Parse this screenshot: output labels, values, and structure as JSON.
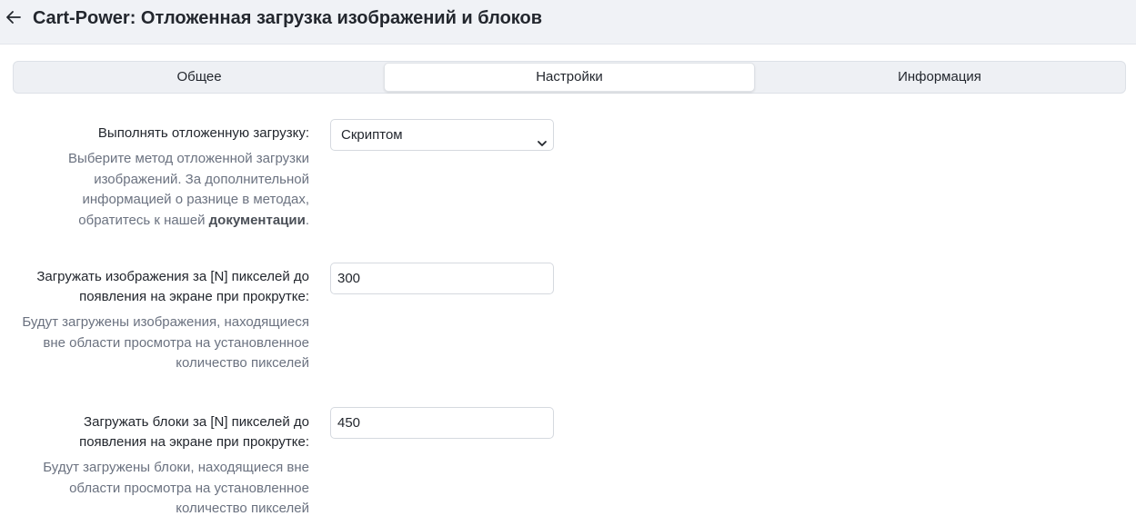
{
  "header": {
    "title": "Cart-Power: Отложенная загрузка изображений и блоков",
    "back_icon": "arrow-left-icon"
  },
  "tabs": [
    {
      "label": "Общее",
      "active": false
    },
    {
      "label": "Настройки",
      "active": true
    },
    {
      "label": "Информация",
      "active": false
    }
  ],
  "settings": {
    "lazy_mode": {
      "label": "Выполнять отложенную загрузку:",
      "help_text": "Выберите метод отложенной загрузки изображений. За дополнительной информацией о разнице в методах, обратитесь к нашей",
      "help_link": "документации",
      "help_end": ".",
      "value": "Скриптом"
    },
    "images_offset": {
      "label": "Загружать изображения за [N] пикселей до появления на экране при прокрутке:",
      "help_text": "Будут загружены изображения, находящиеся вне области просмотра на установленное количество пикселей",
      "value": "300"
    },
    "blocks_offset": {
      "label": "Загружать блоки за [N] пикселей до появления на экране при прокрутке:",
      "help_text": "Будут загружены блоки, находящиеся вне области просмотра на установленное количество пикселей",
      "value": "450"
    }
  },
  "colors": {
    "header_bg": "#f0f2f6",
    "help_text": "#6b7280",
    "border": "#d5d9df"
  }
}
